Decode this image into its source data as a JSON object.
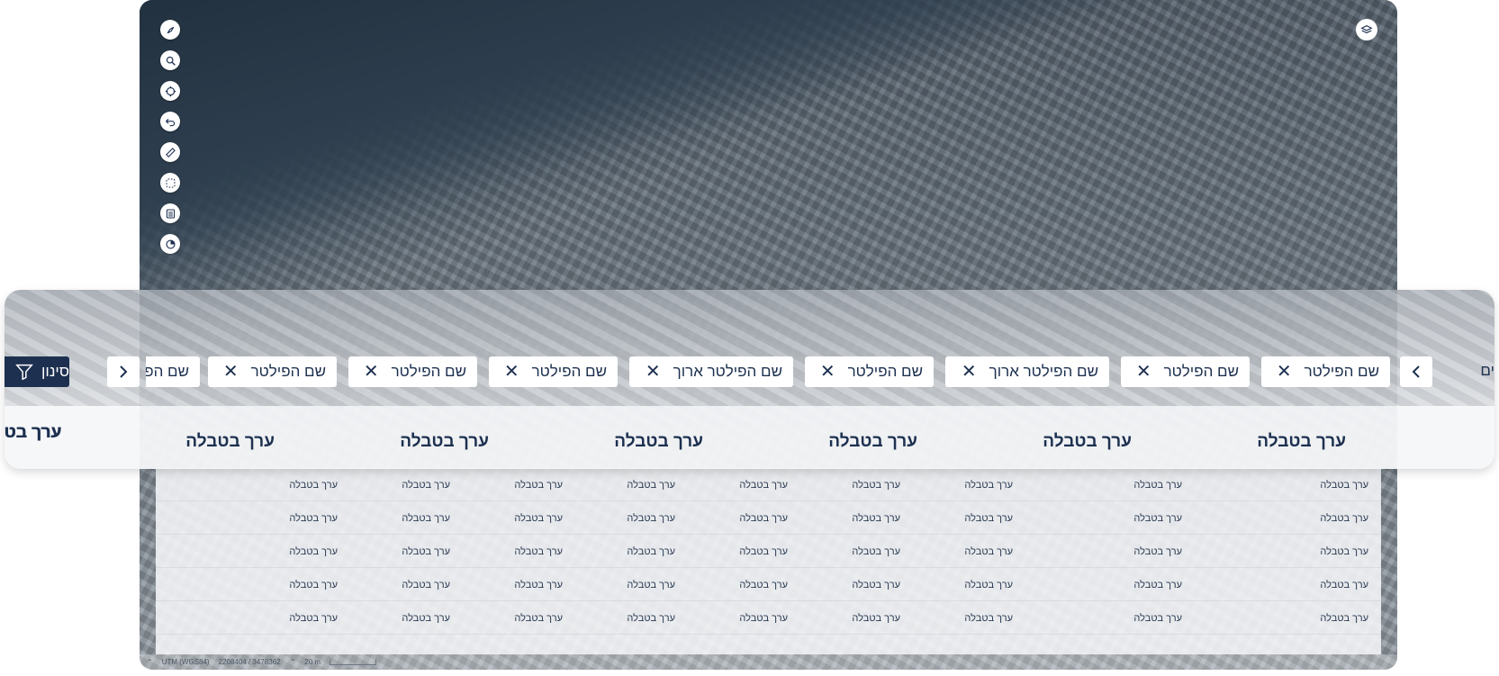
{
  "map": {
    "tools": [
      "compass-icon",
      "search-icon",
      "locate-icon",
      "undo-icon",
      "ruler-icon",
      "select-area-icon",
      "legend-icon",
      "pie-chart-icon"
    ],
    "status": {
      "crs": "UTM (WGS84)",
      "coords": "2208404 / 3478362",
      "scale": "20 m"
    }
  },
  "filters": {
    "button_label": "סינון",
    "edge_fragment": "ים",
    "chips": [
      "שם הפילטר",
      "שם הפילטר",
      "שם הפילטר ארוך",
      "שם הפילטר",
      "שם הפילטר ארוך",
      "שם הפילטר",
      "שם הפילטר",
      "שם הפילטר",
      "שם הפילטר"
    ],
    "clear_glyph": "✕"
  },
  "table": {
    "headers": [
      "ערך בטבלה",
      "ערך בטבלה",
      "ערך בטבלה",
      "ערך בטבלה",
      "ערך בטבלה",
      "ערך בטבלה",
      "ערך בטבלה",
      "ערך בט"
    ],
    "rows": [
      [
        "ערך בטבלה",
        "ערך בטבלה",
        "ערך בטבלה",
        "ערך בטבלה",
        "ערך בטבלה",
        "ערך בטבלה",
        "ערך בטבלה",
        "ערך בטבלה",
        "ערך בטבלה"
      ],
      [
        "ערך בטבלה",
        "ערך בטבלה",
        "ערך בטבלה",
        "ערך בטבלה",
        "ערך בטבלה",
        "ערך בטבלה",
        "ערך בטבלה",
        "ערך בטבלה",
        "ערך בטבלה"
      ],
      [
        "ערך בטבלה",
        "ערך בטבלה",
        "ערך בטבלה",
        "ערך בטבלה",
        "ערך בטבלה",
        "ערך בטבלה",
        "ערך בטבלה",
        "ערך בטבלה",
        "ערך בטבלה"
      ],
      [
        "ערך בטבלה",
        "ערך בטבלה",
        "ערך בטבלה",
        "ערך בטבלה",
        "ערך בטבלה",
        "ערך בטבלה",
        "ערך בטבלה",
        "ערך בטבלה",
        "ערך בטבלה"
      ],
      [
        "ערך בטבלה",
        "ערך בטבלה",
        "ערך בטבלה",
        "ערך בטבלה",
        "ערך בטבלה",
        "ערך בטבלה",
        "ערך בטבלה",
        "ערך בטבלה",
        "ערך בטבלה"
      ]
    ]
  },
  "colors": {
    "primary": "#1d3050",
    "panel": "#f6f7f9"
  }
}
